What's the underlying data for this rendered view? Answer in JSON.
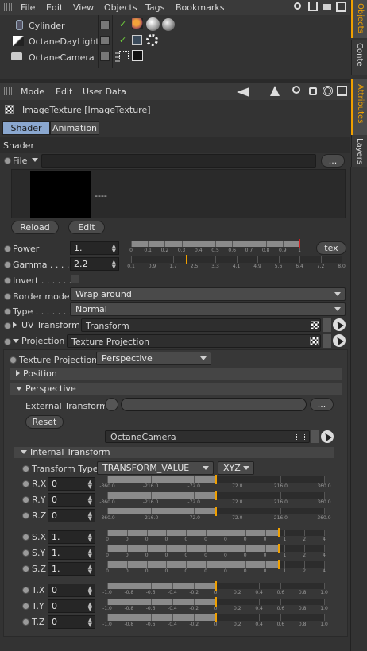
{
  "menubar": {
    "items": [
      "File",
      "Edit",
      "View",
      "Objects",
      "Tags",
      "Bookmarks"
    ]
  },
  "objects": [
    {
      "name": "Cylinder"
    },
    {
      "name": "OctaneDayLight"
    },
    {
      "name": "OctaneCamera"
    }
  ],
  "side_tabs": {
    "objects": "Objects",
    "content": "Conte",
    "attributes": "Attributes",
    "layers": "Layers"
  },
  "attr_menu": {
    "items": [
      "Mode",
      "Edit",
      "User Data"
    ]
  },
  "header": {
    "title": "ImageTexture [ImageTexture]"
  },
  "tabs": {
    "shader": "Shader",
    "animation": "Animation"
  },
  "section_title": "Shader",
  "file": {
    "label": "File",
    "value": "",
    "browse": "...",
    "preview_text": "----",
    "reload": "Reload",
    "edit": "Edit"
  },
  "power": {
    "label": "Power",
    "value": "1.",
    "tex_btn": "tex",
    "ticks": [
      "0",
      "0.1",
      "0.2",
      "0.3",
      "0.4",
      "0.5",
      "0.6",
      "0.7",
      "0.8",
      "0.9",
      "1"
    ],
    "level": 1.0
  },
  "gamma": {
    "label": "Gamma . . . . .",
    "value": "2.2",
    "ticks": [
      "0.1",
      "0.9",
      "1.7",
      "2.5",
      "3.3",
      "4.1",
      "4.9",
      "5.6",
      "6.4",
      "7.2",
      "8.0"
    ],
    "level": 2.2
  },
  "invert": {
    "label": "Invert . . . . . . ."
  },
  "border_mode": {
    "label": "Border mode",
    "value": "Wrap around"
  },
  "type": {
    "label": "Type . . . . . . . .",
    "value": "Normal"
  },
  "uv_transform": {
    "label": "UV Transform",
    "value": "Transform"
  },
  "projection": {
    "label": "Projection",
    "value": "Texture Projection"
  },
  "texture_projection": {
    "label": "Texture Projection",
    "value": "Perspective"
  },
  "groups": {
    "position": "Position",
    "perspective": "Perspective",
    "internal": "Internal Transform"
  },
  "external": {
    "label": "External Transform",
    "browse": "...",
    "reset": "Reset",
    "link": "OctaneCamera"
  },
  "transform_type": {
    "label": "Transform Type",
    "value": "TRANSFORM_VALUE",
    "order": "XYZ"
  },
  "rot_ticks": [
    "-360.0",
    "-216.0",
    "-72.0",
    "72.0",
    "216.0",
    "360.0"
  ],
  "scale_ticks": [
    "0",
    "0",
    "0",
    "0",
    "0",
    "0",
    "0",
    "0",
    "0",
    "1",
    "2",
    "4"
  ],
  "trans_ticks": [
    "-1.0",
    "-0.8",
    "-0.6",
    "-0.4",
    "-0.2",
    "0",
    "0.2",
    "0.4",
    "0.6",
    "0.8",
    "1.0"
  ],
  "rows_rot": [
    {
      "label": "R.X",
      "value": "0"
    },
    {
      "label": "R.Y",
      "value": "0"
    },
    {
      "label": "R.Z",
      "value": "0"
    }
  ],
  "rows_scale": [
    {
      "label": "S.X",
      "value": "1."
    },
    {
      "label": "S.Y",
      "value": "1."
    },
    {
      "label": "S.Z",
      "value": "1."
    }
  ],
  "rows_trans": [
    {
      "label": "T.X",
      "value": "0"
    },
    {
      "label": "T.Y",
      "value": "0"
    },
    {
      "label": "T.Z",
      "value": "0"
    }
  ],
  "colors": {
    "accent": "#f0a000",
    "red_marker": "#d02020",
    "active_tab": "#8aa7cf"
  }
}
